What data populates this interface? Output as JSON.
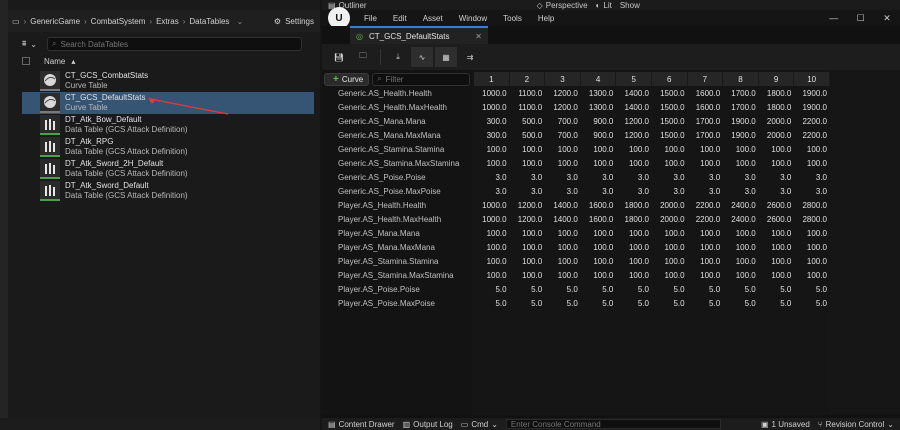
{
  "left": {
    "breadcrumbs": [
      "GenericGame",
      "CombatSystem",
      "Extras",
      "DataTables"
    ],
    "settings_label": "Settings",
    "search_placeholder": "Search DataTables",
    "name_header": "Name",
    "assets": [
      {
        "name": "CT_GCS_CombatStats",
        "type": "Curve Table",
        "kind": "curve"
      },
      {
        "name": "CT_GCS_DefaultStats",
        "type": "Curve Table",
        "kind": "curve"
      },
      {
        "name": "DT_Atk_Bow_Default",
        "type": "Data Table (GCS Attack Definition)",
        "kind": "data"
      },
      {
        "name": "DT_Atk_RPG",
        "type": "Data Table (GCS Attack Definition)",
        "kind": "data"
      },
      {
        "name": "DT_Atk_Sword_2H_Default",
        "type": "Data Table (GCS Attack Definition)",
        "kind": "data"
      },
      {
        "name": "DT_Atk_Sword_Default",
        "type": "Data Table (GCS Attack Definition)",
        "kind": "data"
      }
    ]
  },
  "top": {
    "outliner_label": "Outliner",
    "perspective_label": "Perspective",
    "lit_label": "Lit",
    "show_label": "Show"
  },
  "menu": [
    "File",
    "Edit",
    "Asset",
    "Window",
    "Tools",
    "Help"
  ],
  "tab": {
    "title": "CT_GCS_DefaultStats"
  },
  "table": {
    "add_curve_label": "Curve",
    "filter_placeholder": "Filter",
    "columns": [
      "1",
      "2",
      "3",
      "4",
      "5",
      "6",
      "7",
      "8",
      "9",
      "10"
    ],
    "rows": [
      {
        "name": "Generic.AS_Health.Health",
        "values": [
          "1000.0",
          "1100.0",
          "1200.0",
          "1300.0",
          "1400.0",
          "1500.0",
          "1600.0",
          "1700.0",
          "1800.0",
          "1900.0"
        ]
      },
      {
        "name": "Generic.AS_Health.MaxHealth",
        "values": [
          "1000.0",
          "1100.0",
          "1200.0",
          "1300.0",
          "1400.0",
          "1500.0",
          "1600.0",
          "1700.0",
          "1800.0",
          "1900.0"
        ]
      },
      {
        "name": "Generic.AS_Mana.Mana",
        "values": [
          "300.0",
          "500.0",
          "700.0",
          "900.0",
          "1200.0",
          "1500.0",
          "1700.0",
          "1900.0",
          "2000.0",
          "2200.0"
        ]
      },
      {
        "name": "Generic.AS_Mana.MaxMana",
        "values": [
          "300.0",
          "500.0",
          "700.0",
          "900.0",
          "1200.0",
          "1500.0",
          "1700.0",
          "1900.0",
          "2000.0",
          "2200.0"
        ]
      },
      {
        "name": "Generic.AS_Stamina.Stamina",
        "values": [
          "100.0",
          "100.0",
          "100.0",
          "100.0",
          "100.0",
          "100.0",
          "100.0",
          "100.0",
          "100.0",
          "100.0"
        ]
      },
      {
        "name": "Generic.AS_Stamina.MaxStamina",
        "values": [
          "100.0",
          "100.0",
          "100.0",
          "100.0",
          "100.0",
          "100.0",
          "100.0",
          "100.0",
          "100.0",
          "100.0"
        ]
      },
      {
        "name": "Generic.AS_Poise.Poise",
        "values": [
          "3.0",
          "3.0",
          "3.0",
          "3.0",
          "3.0",
          "3.0",
          "3.0",
          "3.0",
          "3.0",
          "3.0"
        ]
      },
      {
        "name": "Generic.AS_Poise.MaxPoise",
        "values": [
          "3.0",
          "3.0",
          "3.0",
          "3.0",
          "3.0",
          "3.0",
          "3.0",
          "3.0",
          "3.0",
          "3.0"
        ]
      },
      {
        "name": "Player.AS_Health.Health",
        "values": [
          "1000.0",
          "1200.0",
          "1400.0",
          "1600.0",
          "1800.0",
          "2000.0",
          "2200.0",
          "2400.0",
          "2600.0",
          "2800.0"
        ]
      },
      {
        "name": "Player.AS_Health.MaxHealth",
        "values": [
          "1000.0",
          "1200.0",
          "1400.0",
          "1600.0",
          "1800.0",
          "2000.0",
          "2200.0",
          "2400.0",
          "2600.0",
          "2800.0"
        ]
      },
      {
        "name": "Player.AS_Mana.Mana",
        "values": [
          "100.0",
          "100.0",
          "100.0",
          "100.0",
          "100.0",
          "100.0",
          "100.0",
          "100.0",
          "100.0",
          "100.0"
        ]
      },
      {
        "name": "Player.AS_Mana.MaxMana",
        "values": [
          "100.0",
          "100.0",
          "100.0",
          "100.0",
          "100.0",
          "100.0",
          "100.0",
          "100.0",
          "100.0",
          "100.0"
        ]
      },
      {
        "name": "Player.AS_Stamina.Stamina",
        "values": [
          "100.0",
          "100.0",
          "100.0",
          "100.0",
          "100.0",
          "100.0",
          "100.0",
          "100.0",
          "100.0",
          "100.0"
        ]
      },
      {
        "name": "Player.AS_Stamina.MaxStamina",
        "values": [
          "100.0",
          "100.0",
          "100.0",
          "100.0",
          "100.0",
          "100.0",
          "100.0",
          "100.0",
          "100.0",
          "100.0"
        ]
      },
      {
        "name": "Player.AS_Poise.Poise",
        "values": [
          "5.0",
          "5.0",
          "5.0",
          "5.0",
          "5.0",
          "5.0",
          "5.0",
          "5.0",
          "5.0",
          "5.0"
        ]
      },
      {
        "name": "Player.AS_Poise.MaxPoise",
        "values": [
          "5.0",
          "5.0",
          "5.0",
          "5.0",
          "5.0",
          "5.0",
          "5.0",
          "5.0",
          "5.0",
          "5.0"
        ]
      }
    ]
  },
  "status": {
    "content_drawer": "Content Drawer",
    "output_log": "Output Log",
    "cmd_label": "Cmd",
    "console_placeholder": "Enter Console Command",
    "unsaved": "1 Unsaved",
    "revision_control": "Revision Control"
  },
  "colors": {
    "selection": "#365575",
    "accent_green": "#5bbf3f",
    "arrow_red": "#e03a3a",
    "tab_accent": "#3a7ad1"
  }
}
